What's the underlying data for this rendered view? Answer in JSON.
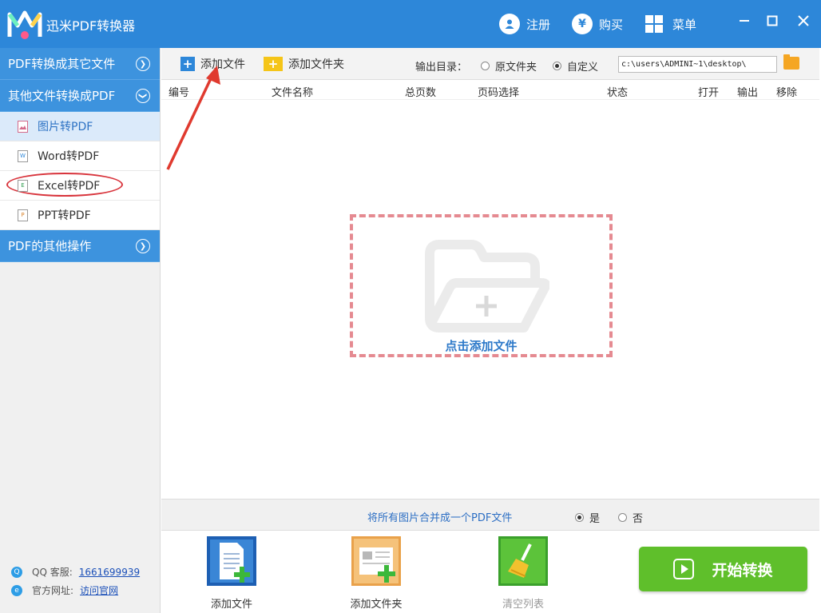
{
  "app": {
    "title": "迅米PDF转换器"
  },
  "titlebar": {
    "register_label": "注册",
    "buy_label": "购买",
    "menu_label": "菜单",
    "buy_glyph": "¥"
  },
  "sidebar": {
    "sections": [
      {
        "label": "PDF转换成其它文件",
        "expanded": false
      },
      {
        "label": "其他文件转换成PDF",
        "expanded": true
      },
      {
        "label": "PDF的其他操作",
        "expanded": false
      }
    ],
    "items": [
      {
        "label": "图片转PDF",
        "icon": "image-file-icon",
        "active": true
      },
      {
        "label": "Word转PDF",
        "icon": "word-file-icon",
        "active": false
      },
      {
        "label": "Excel转PDF",
        "icon": "excel-file-icon",
        "active": false
      },
      {
        "label": "PPT转PDF",
        "icon": "ppt-file-icon",
        "active": false
      }
    ],
    "qq_label": "QQ 客服:",
    "qq_number": "1661699939",
    "website_label": "官方网址:",
    "website_link": "访问官网"
  },
  "toolbar": {
    "add_file_label": "添加文件",
    "add_folder_label": "添加文件夹",
    "output_dir_label": "输出目录：",
    "source_folder_label": "原文件夹",
    "custom_label": "自定义",
    "output_mode": "custom",
    "output_path": "c:\\users\\ADMINI~1\\desktop\\"
  },
  "table": {
    "columns": [
      "编号",
      "文件名称",
      "总页数",
      "页码选择",
      "状态",
      "打开",
      "输出",
      "移除"
    ],
    "rows": []
  },
  "dropzone": {
    "label": "点击添加文件"
  },
  "merge": {
    "label": "将所有图片合并成一个PDF文件",
    "yes_label": "是",
    "no_label": "否",
    "selected": "yes"
  },
  "bottom": {
    "add_file_label": "添加文件",
    "add_folder_label": "添加文件夹",
    "clear_label": "清空列表",
    "start_label": "开始转换"
  },
  "colors": {
    "titlebar": "#2d87d9",
    "sidebar_section": "#3d93de",
    "active_item": "#dbeafa",
    "start_button": "#5fbf2b",
    "dropzone_border": "#e58a91",
    "annotation_red": "#d8333b"
  }
}
